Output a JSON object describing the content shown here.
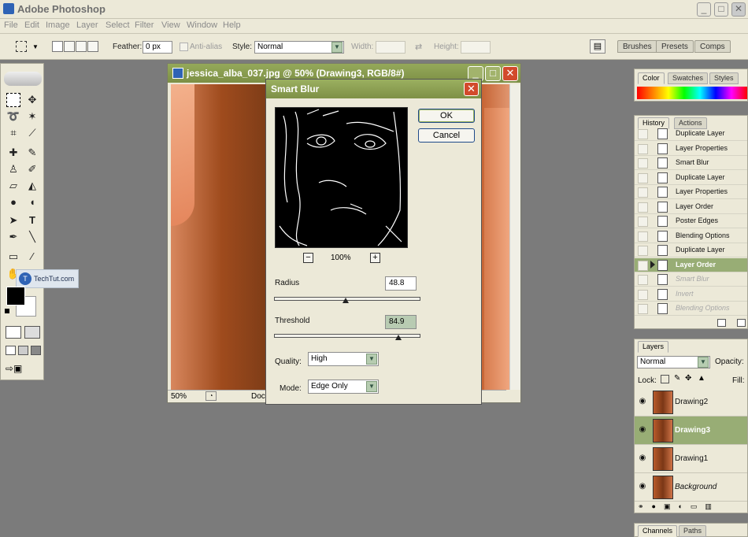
{
  "app": {
    "title": "Adobe Photoshop"
  },
  "window_controls": {
    "minimize": "_",
    "maximize": "□",
    "close": "✕"
  },
  "menu": [
    "File",
    "Edit",
    "Image",
    "Layer",
    "Select",
    "Filter",
    "View",
    "Window",
    "Help"
  ],
  "options_bar": {
    "feather_label": "Feather:",
    "feather_value": "0 px",
    "antialias_label": "Anti-alias",
    "style_label": "Style:",
    "style_value": "Normal",
    "width_label": "Width:",
    "height_label": "Height:",
    "well_tabs": [
      "Brushes",
      "Presets",
      "Comps"
    ]
  },
  "watermark": {
    "text": "TechTut.com"
  },
  "document": {
    "title": "jessica_alba_037.jpg @ 50% (Drawing3, RGB/8#)",
    "zoom": "50%",
    "status": "Doc"
  },
  "smart_blur": {
    "title": "Smart Blur",
    "ok_label": "OK",
    "cancel_label": "Cancel",
    "zoom_level": "100%",
    "zoom_minus": "−",
    "zoom_plus": "+",
    "radius_label": "Radius",
    "radius_value": "48.8",
    "radius_fraction": 0.49,
    "threshold_label": "Threshold",
    "threshold_value": "84.9",
    "threshold_fraction": 0.85,
    "quality_label": "Quality:",
    "quality_value": "High",
    "mode_label": "Mode:",
    "mode_value": "Edge Only"
  },
  "color_panel": {
    "tabs": [
      "Color",
      "Swatches",
      "Styles"
    ]
  },
  "history_panel": {
    "tabs": [
      "History",
      "Actions"
    ],
    "items": [
      {
        "label": "Duplicate Layer",
        "state": "normal"
      },
      {
        "label": "Layer Properties",
        "state": "normal"
      },
      {
        "label": "Smart Blur",
        "state": "normal"
      },
      {
        "label": "Duplicate Layer",
        "state": "normal"
      },
      {
        "label": "Layer Properties",
        "state": "normal"
      },
      {
        "label": "Layer Order",
        "state": "normal"
      },
      {
        "label": "Poster Edges",
        "state": "normal"
      },
      {
        "label": "Blending Options",
        "state": "normal"
      },
      {
        "label": "Duplicate Layer",
        "state": "normal"
      },
      {
        "label": "Layer Order",
        "state": "active"
      },
      {
        "label": "Smart Blur",
        "state": "dimmed"
      },
      {
        "label": "Invert",
        "state": "dimmed"
      },
      {
        "label": "Blending Options",
        "state": "dimmed"
      }
    ]
  },
  "layers_panel": {
    "tab": "Layers",
    "blend_mode": "Normal",
    "opacity_label": "Opacity:",
    "lock_label": "Lock:",
    "fill_label": "Fill:",
    "layers": [
      {
        "name": "Drawing2",
        "active": false,
        "italic": false
      },
      {
        "name": "Drawing3",
        "active": true,
        "italic": false
      },
      {
        "name": "Drawing1",
        "active": false,
        "italic": false
      },
      {
        "name": "Background",
        "active": false,
        "italic": true
      }
    ]
  },
  "channels_panel": {
    "tabs": [
      "Channels",
      "Paths"
    ]
  }
}
